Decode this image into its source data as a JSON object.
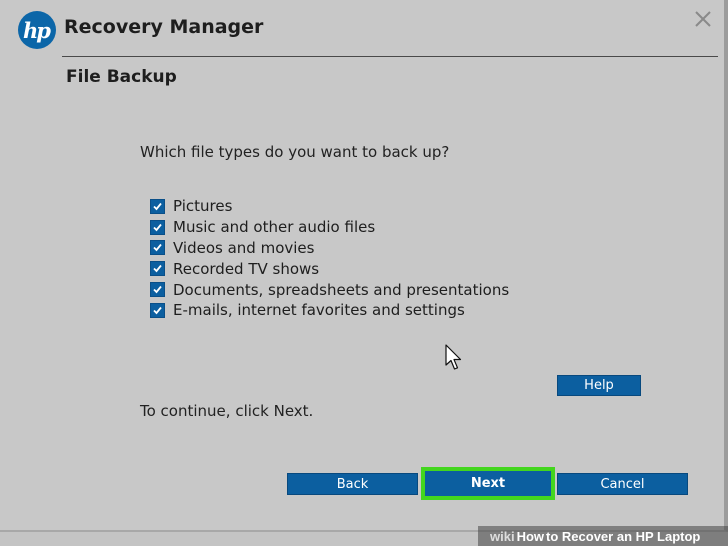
{
  "app": {
    "logo_text": "hp",
    "title": "Recovery Manager",
    "brand_color": "#0c66a8"
  },
  "page": {
    "title": "File Backup",
    "question": "Which file types do you want to back up?",
    "continue_text": "To continue, click Next."
  },
  "options": [
    {
      "label": "Pictures",
      "checked": true
    },
    {
      "label": "Music and other audio files",
      "checked": true
    },
    {
      "label": "Videos and movies",
      "checked": true
    },
    {
      "label": "Recorded TV shows",
      "checked": true
    },
    {
      "label": "Documents, spreadsheets and presentations",
      "checked": true
    },
    {
      "label": "E-mails, internet favorites and settings",
      "checked": true
    }
  ],
  "buttons": {
    "help": "Help",
    "back": "Back",
    "next": "Next",
    "cancel": "Cancel"
  },
  "highlight_color": "#43d61e",
  "watermark": {
    "wiki": "wiki",
    "how": "How",
    "rest": " to Recover an HP Laptop"
  },
  "icons": {
    "close": "close-icon",
    "cursor": "mouse-pointer-icon",
    "check": "checkmark-icon"
  }
}
